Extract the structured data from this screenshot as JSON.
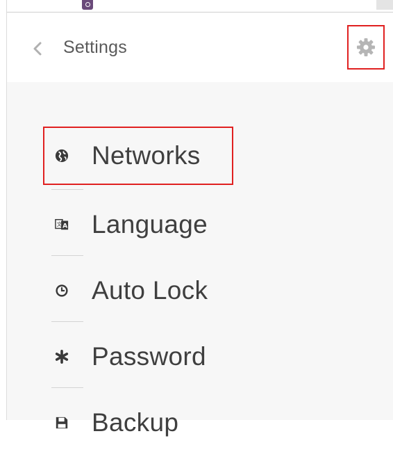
{
  "header": {
    "title": "Settings",
    "back_icon": "chevron-left-icon",
    "settings_icon": "gear-icon"
  },
  "menu": {
    "items": [
      {
        "label": "Networks",
        "icon": "globe-icon"
      },
      {
        "label": "Language",
        "icon": "translate-icon"
      },
      {
        "label": "Auto Lock",
        "icon": "clock-icon"
      },
      {
        "label": "Password",
        "icon": "asterisk-icon"
      },
      {
        "label": "Backup",
        "icon": "save-icon"
      }
    ]
  },
  "colors": {
    "highlight": "#e02020",
    "text": "#3f3f3f",
    "header_text": "#5a5a5a",
    "icon": "#3a3a3a",
    "muted_icon": "#b0b0b0",
    "content_bg": "#f7f7f7"
  }
}
